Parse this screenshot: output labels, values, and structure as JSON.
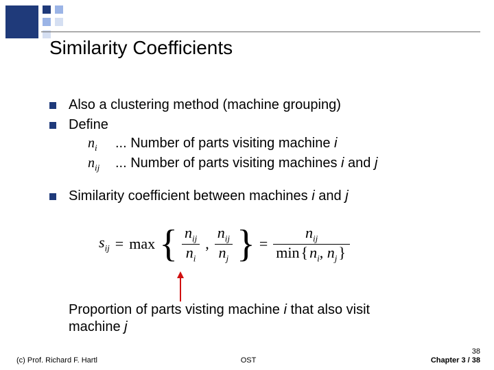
{
  "title": "Similarity Coefficients",
  "bullets": {
    "b1": "Also a clustering method (machine grouping)",
    "b2": "Define",
    "def_ni_sym_base": "n",
    "def_ni_sym_sub": "i",
    "def_ni_text_pre": "... Number of parts visiting machine ",
    "def_ni_text_var": "i",
    "def_nij_sym_base": "n",
    "def_nij_sym_sub": "ij",
    "def_nij_text_pre": "... Number of parts visiting machines ",
    "def_nij_text_var1": "i",
    "def_nij_text_mid": " and ",
    "def_nij_text_var2": "j",
    "b3_pre": "Similarity coefficient between machines ",
    "b3_var1": "i",
    "b3_mid": " and ",
    "b3_var2": "j"
  },
  "formula": {
    "lhs_base": "s",
    "lhs_sub": "ij",
    "eq": " = ",
    "max": "max",
    "n": "n",
    "sub_ij": "ij",
    "sub_i": "i",
    "sub_j": "j",
    "comma": " , ",
    "eq2": " = ",
    "min": "min",
    "sep": ", ",
    "lb": "{",
    "rb": "}"
  },
  "caption_pre": "Proportion of parts visting machine ",
  "caption_var1": "i",
  "caption_mid": " that also visit machine ",
  "caption_var2": "j",
  "footer": {
    "left": "(c) Prof. Richard F. Hartl",
    "center": "OST",
    "page_small": "38",
    "right": "Chapter 3 / 38"
  }
}
